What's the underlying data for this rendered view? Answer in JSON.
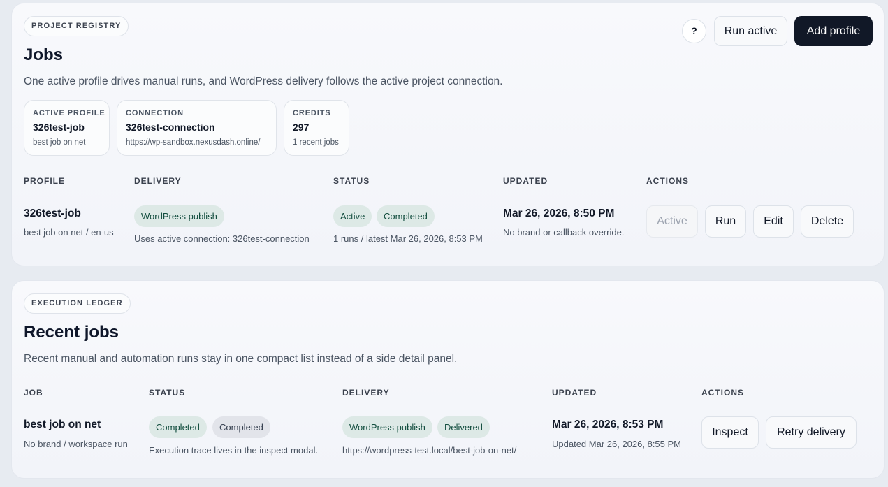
{
  "registry": {
    "eyebrow": "PROJECT REGISTRY",
    "title": "Jobs",
    "subtitle": "One active profile drives manual runs, and WordPress delivery follows the active project connection.",
    "help_label": "?",
    "run_active_label": "Run active",
    "add_profile_label": "Add profile",
    "stats": [
      {
        "label": "ACTIVE PROFILE",
        "value": "326test-job",
        "note": "best job on net"
      },
      {
        "label": "CONNECTION",
        "value": "326test-connection",
        "note": "https://wp-sandbox.nexusdash.online/"
      },
      {
        "label": "CREDITS",
        "value": "297",
        "note": "1 recent jobs"
      }
    ],
    "columns": [
      "PROFILE",
      "DELIVERY",
      "STATUS",
      "UPDATED",
      "ACTIONS"
    ],
    "rows": [
      {
        "profile": "326test-job",
        "profile_sub": "best job on net / en-us",
        "delivery_pill": "WordPress publish",
        "delivery_sub": "Uses active connection: 326test-connection",
        "status_pills": [
          "Active",
          "Completed"
        ],
        "status_sub": "1 runs / latest Mar 26, 2026, 8:53 PM",
        "updated": "Mar 26, 2026, 8:50 PM",
        "updated_sub": "No brand or callback override.",
        "actions": [
          "Active",
          "Run",
          "Edit",
          "Delete"
        ]
      }
    ]
  },
  "ledger": {
    "eyebrow": "EXECUTION LEDGER",
    "title": "Recent jobs",
    "subtitle": "Recent manual and automation runs stay in one compact list instead of a side detail panel.",
    "columns": [
      "JOB",
      "STATUS",
      "DELIVERY",
      "UPDATED",
      "ACTIONS"
    ],
    "rows": [
      {
        "job": "best job on net",
        "job_sub": "No brand / workspace run",
        "status_pills": [
          "Completed",
          "Completed"
        ],
        "status_sub": "Execution trace lives in the inspect modal.",
        "delivery_pills": [
          "WordPress publish",
          "Delivered"
        ],
        "delivery_sub": "https://wordpress-test.local/best-job-on-net/",
        "updated": "Mar 26, 2026, 8:53 PM",
        "updated_sub": "Updated Mar 26, 2026, 8:55 PM",
        "actions": [
          "Inspect",
          "Retry delivery"
        ]
      }
    ]
  }
}
